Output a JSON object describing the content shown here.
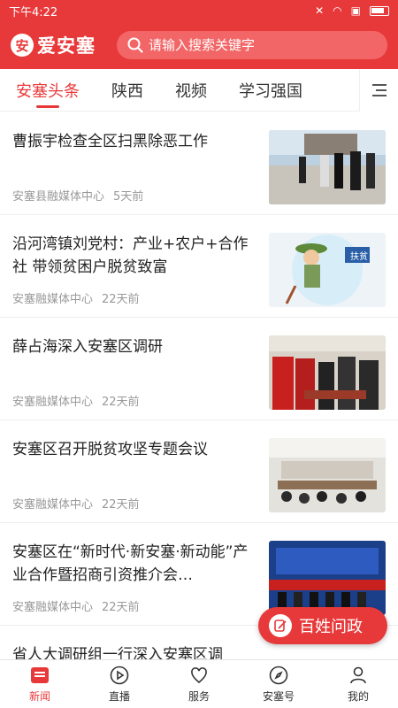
{
  "status_bar": {
    "time": "下午4:22"
  },
  "app": {
    "logo_text": "爱安塞",
    "logo_glyph": "安"
  },
  "search": {
    "placeholder": "请输入搜索关键字"
  },
  "tabs": [
    {
      "label": "安塞头条",
      "active": true
    },
    {
      "label": "陕西",
      "active": false
    },
    {
      "label": "视频",
      "active": false
    },
    {
      "label": "学习强国",
      "active": false
    }
  ],
  "articles": [
    {
      "title": "曹振宇检查全区扫黑除恶工作",
      "source": "安塞县融媒体中心",
      "time": "5天前"
    },
    {
      "title": "沿河湾镇刘党村：产业+农户+合作社 带领贫困户脱贫致富",
      "source": "安塞融媒体中心",
      "time": "22天前"
    },
    {
      "title": "薛占海深入安塞区调研",
      "source": "安塞融媒体中心",
      "time": "22天前"
    },
    {
      "title": "安塞区召开脱贫攻坚专题会议",
      "source": "安塞融媒体中心",
      "time": "22天前"
    },
    {
      "title": "安塞区在“新时代·新安塞·新动能”产业合作暨招商引资推介会…",
      "source": "安塞融媒体中心",
      "time": "22天前"
    },
    {
      "title": "省人大调研组一行深入安塞区调",
      "source": "",
      "time": ""
    }
  ],
  "fab": {
    "label": "百姓问政"
  },
  "bottom_nav": [
    {
      "label": "新闻",
      "icon": "news-icon",
      "active": true
    },
    {
      "label": "直播",
      "icon": "live-icon",
      "active": false
    },
    {
      "label": "服务",
      "icon": "service-icon",
      "active": false
    },
    {
      "label": "安塞号",
      "icon": "compass-icon",
      "active": false
    },
    {
      "label": "我的",
      "icon": "user-icon",
      "active": false
    }
  ],
  "colors": {
    "brand": "#e8393a",
    "text": "#222222",
    "meta": "#999999"
  }
}
